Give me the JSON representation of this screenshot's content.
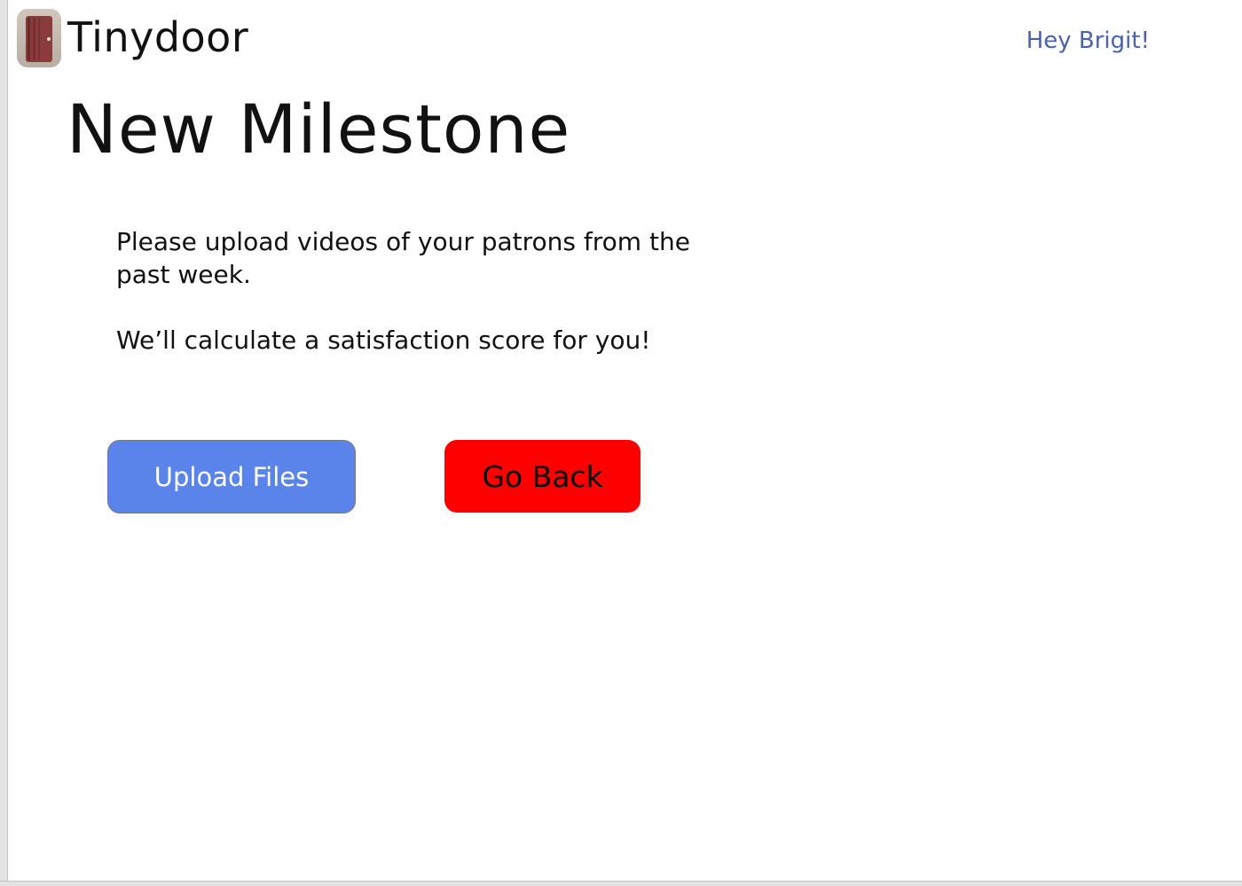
{
  "header": {
    "logo_icon": "door-icon",
    "brand": "Tinydoor",
    "greeting": "Hey Brigit!"
  },
  "main": {
    "title": "New Milestone",
    "paragraph_1": "Please upload videos of your patrons from the past week.",
    "paragraph_2": "We’ll calculate a satisfaction score for you!"
  },
  "actions": {
    "upload_label": "Upload Files",
    "back_label": "Go Back"
  },
  "colors": {
    "greeting": "#4b62a7",
    "upload_button": "#5b84ea",
    "back_button": "#ff0000"
  }
}
